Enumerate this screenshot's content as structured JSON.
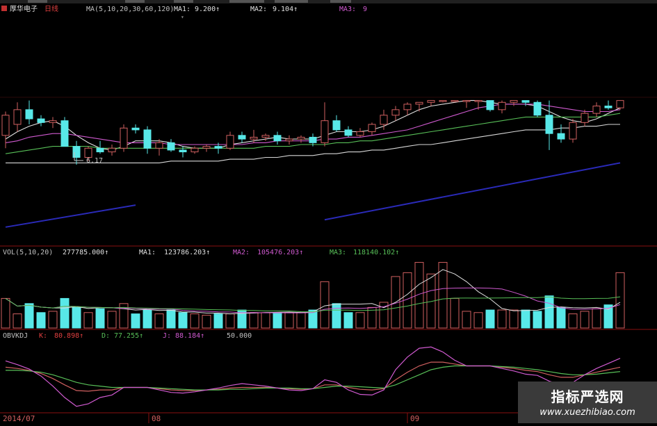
{
  "stock_name": "厚华电子",
  "period": "日线",
  "price_ma_label": "MA(5,10,20,30,60,120)",
  "ma1_label": "MA1:",
  "ma1_value": "9.200↑",
  "ma2_label": "MA2:",
  "ma2_value": "9.104↑",
  "ma3_label": "MA3:",
  "ma3_value": "9",
  "low_marker": "6.17",
  "vol_label": "VOL(5,10,20)",
  "vol_value": "277785.000↑",
  "vol_ma1_label": "MA1:",
  "vol_ma1_value": "123786.203↑",
  "vol_ma2_label": "MA2:",
  "vol_ma2_value": "105476.203↑",
  "vol_ma3_label": "MA3:",
  "vol_ma3_value": "118140.102↑",
  "kdj_label": "OBVKDJ",
  "k_label": "K:",
  "k_value": "80.898↑",
  "d_label": "D:",
  "d_value": "77.255↑",
  "j_label": "J:",
  "j_value": "88.184↑",
  "kdj_level": "50.000",
  "date_labels": [
    "2014/07",
    "08",
    "09"
  ],
  "watermark": {
    "title": "指标严选网",
    "url": "www.xuezhibiao.com"
  },
  "colors": {
    "background": "#000000",
    "up": "#d06060",
    "down": "#58e8e8",
    "ma1": "#e0e0e0",
    "ma2": "#d05ad0",
    "ma3": "#58c058",
    "trend": "#2a2ab8",
    "grid": "#8a1010"
  },
  "chart_data": {
    "type": "candlestick",
    "x": [
      1,
      2,
      3,
      4,
      5,
      6,
      7,
      8,
      9,
      10,
      11,
      12,
      13,
      14,
      15,
      16,
      17,
      18,
      19,
      20,
      21,
      22,
      23,
      24,
      25,
      26,
      27,
      28,
      29,
      30,
      31,
      32,
      33,
      34,
      35,
      36,
      37,
      38,
      39,
      40,
      41,
      42,
      43,
      44,
      45,
      46,
      47,
      48,
      49,
      50,
      51,
      52,
      53
    ],
    "ohlc": [
      [
        8.0,
        9.3,
        7.3,
        9.1
      ],
      [
        8.6,
        9.8,
        8.2,
        9.4
      ],
      [
        9.4,
        9.9,
        8.6,
        8.9
      ],
      [
        8.9,
        9.1,
        8.5,
        8.7
      ],
      [
        8.7,
        9.0,
        8.4,
        8.8
      ],
      [
        8.8,
        9.0,
        8.4,
        7.4
      ],
      [
        7.4,
        7.7,
        6.4,
        6.8
      ],
      [
        6.8,
        7.4,
        6.6,
        7.3
      ],
      [
        7.3,
        7.7,
        7.0,
        7.1
      ],
      [
        7.1,
        7.5,
        6.9,
        7.3
      ],
      [
        7.3,
        8.6,
        7.1,
        8.4
      ],
      [
        8.4,
        8.6,
        8.1,
        8.3
      ],
      [
        8.3,
        8.5,
        7.0,
        7.3
      ],
      [
        7.3,
        7.8,
        6.9,
        7.6
      ],
      [
        7.6,
        7.8,
        7.1,
        7.2
      ],
      [
        7.2,
        7.4,
        6.8,
        7.1
      ],
      [
        7.1,
        7.4,
        7.0,
        7.3
      ],
      [
        7.3,
        7.5,
        7.1,
        7.4
      ],
      [
        7.4,
        7.6,
        7.0,
        7.3
      ],
      [
        7.3,
        8.2,
        7.2,
        8.0
      ],
      [
        8.0,
        8.2,
        7.6,
        7.8
      ],
      [
        7.8,
        8.3,
        7.6,
        7.9
      ],
      [
        7.9,
        8.1,
        7.7,
        8.0
      ],
      [
        8.0,
        8.2,
        7.5,
        7.7
      ],
      [
        7.7,
        8.0,
        7.5,
        7.8
      ],
      [
        7.8,
        8.0,
        7.6,
        7.9
      ],
      [
        7.9,
        8.1,
        7.4,
        7.6
      ],
      [
        7.6,
        9.8,
        7.4,
        8.8
      ],
      [
        8.8,
        9.1,
        8.2,
        8.3
      ],
      [
        8.3,
        8.5,
        7.9,
        8.0
      ],
      [
        8.0,
        8.4,
        7.9,
        8.2
      ],
      [
        8.2,
        8.7,
        8.0,
        8.6
      ],
      [
        8.6,
        9.4,
        8.3,
        9.1
      ],
      [
        9.1,
        9.6,
        8.8,
        9.4
      ],
      [
        9.4,
        9.8,
        9.1,
        9.7
      ],
      [
        9.7,
        9.8,
        9.3,
        9.8
      ],
      [
        9.8,
        9.9,
        9.6,
        9.9
      ],
      [
        9.9,
        9.9,
        9.8,
        9.9
      ],
      [
        9.9,
        9.9,
        9.8,
        9.9
      ],
      [
        9.9,
        9.9,
        9.5,
        9.9
      ],
      [
        9.9,
        9.9,
        9.4,
        9.9
      ],
      [
        9.9,
        9.9,
        9.3,
        9.4
      ],
      [
        9.4,
        9.9,
        9.2,
        9.8
      ],
      [
        9.8,
        9.9,
        9.6,
        9.9
      ],
      [
        9.9,
        9.9,
        9.6,
        9.8
      ],
      [
        9.8,
        9.9,
        9.0,
        9.1
      ],
      [
        9.1,
        9.9,
        7.2,
        8.1
      ],
      [
        8.1,
        8.6,
        7.6,
        7.8
      ],
      [
        7.8,
        8.9,
        7.6,
        8.7
      ],
      [
        8.7,
        9.4,
        8.5,
        9.2
      ],
      [
        9.2,
        9.8,
        9.0,
        9.6
      ],
      [
        9.6,
        9.9,
        9.4,
        9.5
      ],
      [
        9.5,
        9.9,
        9.4,
        9.9
      ]
    ],
    "ma_series": [
      {
        "name": "MA1",
        "values": [
          7.8,
          8.2,
          8.5,
          8.7,
          8.8,
          8.5,
          8.0,
          7.6,
          7.3,
          7.2,
          7.4,
          7.7,
          7.7,
          7.7,
          7.6,
          7.4,
          7.3,
          7.3,
          7.3,
          7.5,
          7.6,
          7.7,
          7.8,
          7.9,
          7.8,
          7.8,
          7.8,
          8.0,
          8.2,
          8.2,
          8.2,
          8.3,
          8.5,
          8.8,
          9.1,
          9.4,
          9.6,
          9.7,
          9.8,
          9.9,
          9.9,
          9.8,
          9.7,
          9.7,
          9.7,
          9.6,
          9.3,
          9.0,
          8.8,
          8.7,
          8.9,
          9.2,
          9.5
        ]
      },
      {
        "name": "MA2",
        "values": [
          7.6,
          7.7,
          7.9,
          8.0,
          8.1,
          8.1,
          8.0,
          7.9,
          7.8,
          7.7,
          7.6,
          7.6,
          7.6,
          7.6,
          7.5,
          7.5,
          7.5,
          7.5,
          7.5,
          7.5,
          7.5,
          7.6,
          7.6,
          7.7,
          7.7,
          7.7,
          7.7,
          7.8,
          7.8,
          7.9,
          7.9,
          8.0,
          8.1,
          8.2,
          8.3,
          8.5,
          8.7,
          8.9,
          9.1,
          9.3,
          9.5,
          9.6,
          9.7,
          9.7,
          9.7,
          9.7,
          9.6,
          9.5,
          9.4,
          9.3,
          9.3,
          9.3,
          9.4
        ]
      },
      {
        "name": "MA3",
        "values": [
          7.0,
          7.1,
          7.2,
          7.3,
          7.4,
          7.4,
          7.4,
          7.4,
          7.3,
          7.3,
          7.3,
          7.3,
          7.3,
          7.3,
          7.3,
          7.3,
          7.3,
          7.3,
          7.3,
          7.3,
          7.3,
          7.3,
          7.4,
          7.4,
          7.4,
          7.5,
          7.5,
          7.5,
          7.6,
          7.6,
          7.7,
          7.7,
          7.8,
          7.9,
          8.0,
          8.1,
          8.2,
          8.3,
          8.4,
          8.5,
          8.6,
          8.7,
          8.8,
          8.9,
          9.0,
          9.0,
          9.0,
          9.0,
          9.0,
          9.0,
          9.0,
          9.1,
          9.2
        ]
      },
      {
        "name": "MA4",
        "values": [
          6.5,
          6.5,
          6.5,
          6.5,
          6.5,
          6.5,
          6.5,
          6.5,
          6.5,
          6.5,
          6.5,
          6.5,
          6.5,
          6.5,
          6.6,
          6.6,
          6.6,
          6.6,
          6.6,
          6.7,
          6.7,
          6.7,
          6.8,
          6.8,
          6.9,
          6.9,
          6.9,
          7.0,
          7.0,
          7.1,
          7.1,
          7.2,
          7.2,
          7.3,
          7.4,
          7.5,
          7.5,
          7.6,
          7.7,
          7.8,
          7.9,
          8.0,
          8.1,
          8.2,
          8.3,
          8.3,
          8.3,
          8.4,
          8.4,
          8.5,
          8.5,
          8.6,
          8.6
        ]
      }
    ],
    "trendlines": [
      {
        "x": [
          1,
          12
        ],
        "y": [
          3.0,
          4.2
        ]
      },
      {
        "x": [
          28,
          53
        ],
        "y": [
          3.4,
          6.5
        ]
      }
    ],
    "volume": [
      115,
      55,
      95,
      60,
      65,
      115,
      80,
      60,
      75,
      65,
      95,
      55,
      70,
      55,
      70,
      60,
      55,
      50,
      55,
      55,
      70,
      60,
      60,
      60,
      60,
      60,
      70,
      180,
      95,
      60,
      60,
      80,
      100,
      200,
      215,
      255,
      210,
      255,
      115,
      65,
      60,
      70,
      70,
      70,
      70,
      65,
      125,
      80,
      55,
      65,
      75,
      90,
      215
    ],
    "volume_ylim": [
      0,
      270
    ],
    "kdj": [
      {
        "name": "K",
        "values": [
          70,
          68,
          65,
          60,
          52,
          42,
          33,
          32,
          34,
          34,
          38,
          38,
          38,
          36,
          34,
          33,
          33,
          34,
          35,
          37,
          38,
          38,
          38,
          37,
          36,
          35,
          36,
          42,
          42,
          38,
          35,
          34,
          36,
          50,
          62,
          72,
          78,
          78,
          75,
          72,
          72,
          72,
          70,
          68,
          65,
          63,
          58,
          54,
          54,
          58,
          62,
          66,
          70
        ]
      },
      {
        "name": "D",
        "values": [
          65,
          65,
          64,
          62,
          58,
          52,
          46,
          42,
          40,
          38,
          38,
          38,
          38,
          37,
          36,
          35,
          34,
          34,
          34,
          35,
          35,
          36,
          37,
          37,
          37,
          36,
          36,
          38,
          40,
          40,
          39,
          38,
          37,
          42,
          50,
          58,
          66,
          70,
          72,
          72,
          72,
          72,
          71,
          70,
          68,
          66,
          63,
          60,
          58,
          58,
          59,
          61,
          63
        ]
      },
      {
        "name": "J",
        "values": [
          80,
          74,
          67,
          56,
          40,
          22,
          8,
          12,
          22,
          26,
          38,
          38,
          38,
          34,
          30,
          29,
          31,
          34,
          37,
          41,
          44,
          42,
          40,
          37,
          34,
          33,
          36,
          50,
          46,
          34,
          27,
          26,
          34,
          66,
          86,
          100,
          102,
          94,
          81,
          72,
          72,
          72,
          68,
          64,
          59,
          57,
          48,
          42,
          46,
          58,
          68,
          76,
          84
        ]
      }
    ],
    "kdj_ylim": [
      0,
      110
    ]
  }
}
